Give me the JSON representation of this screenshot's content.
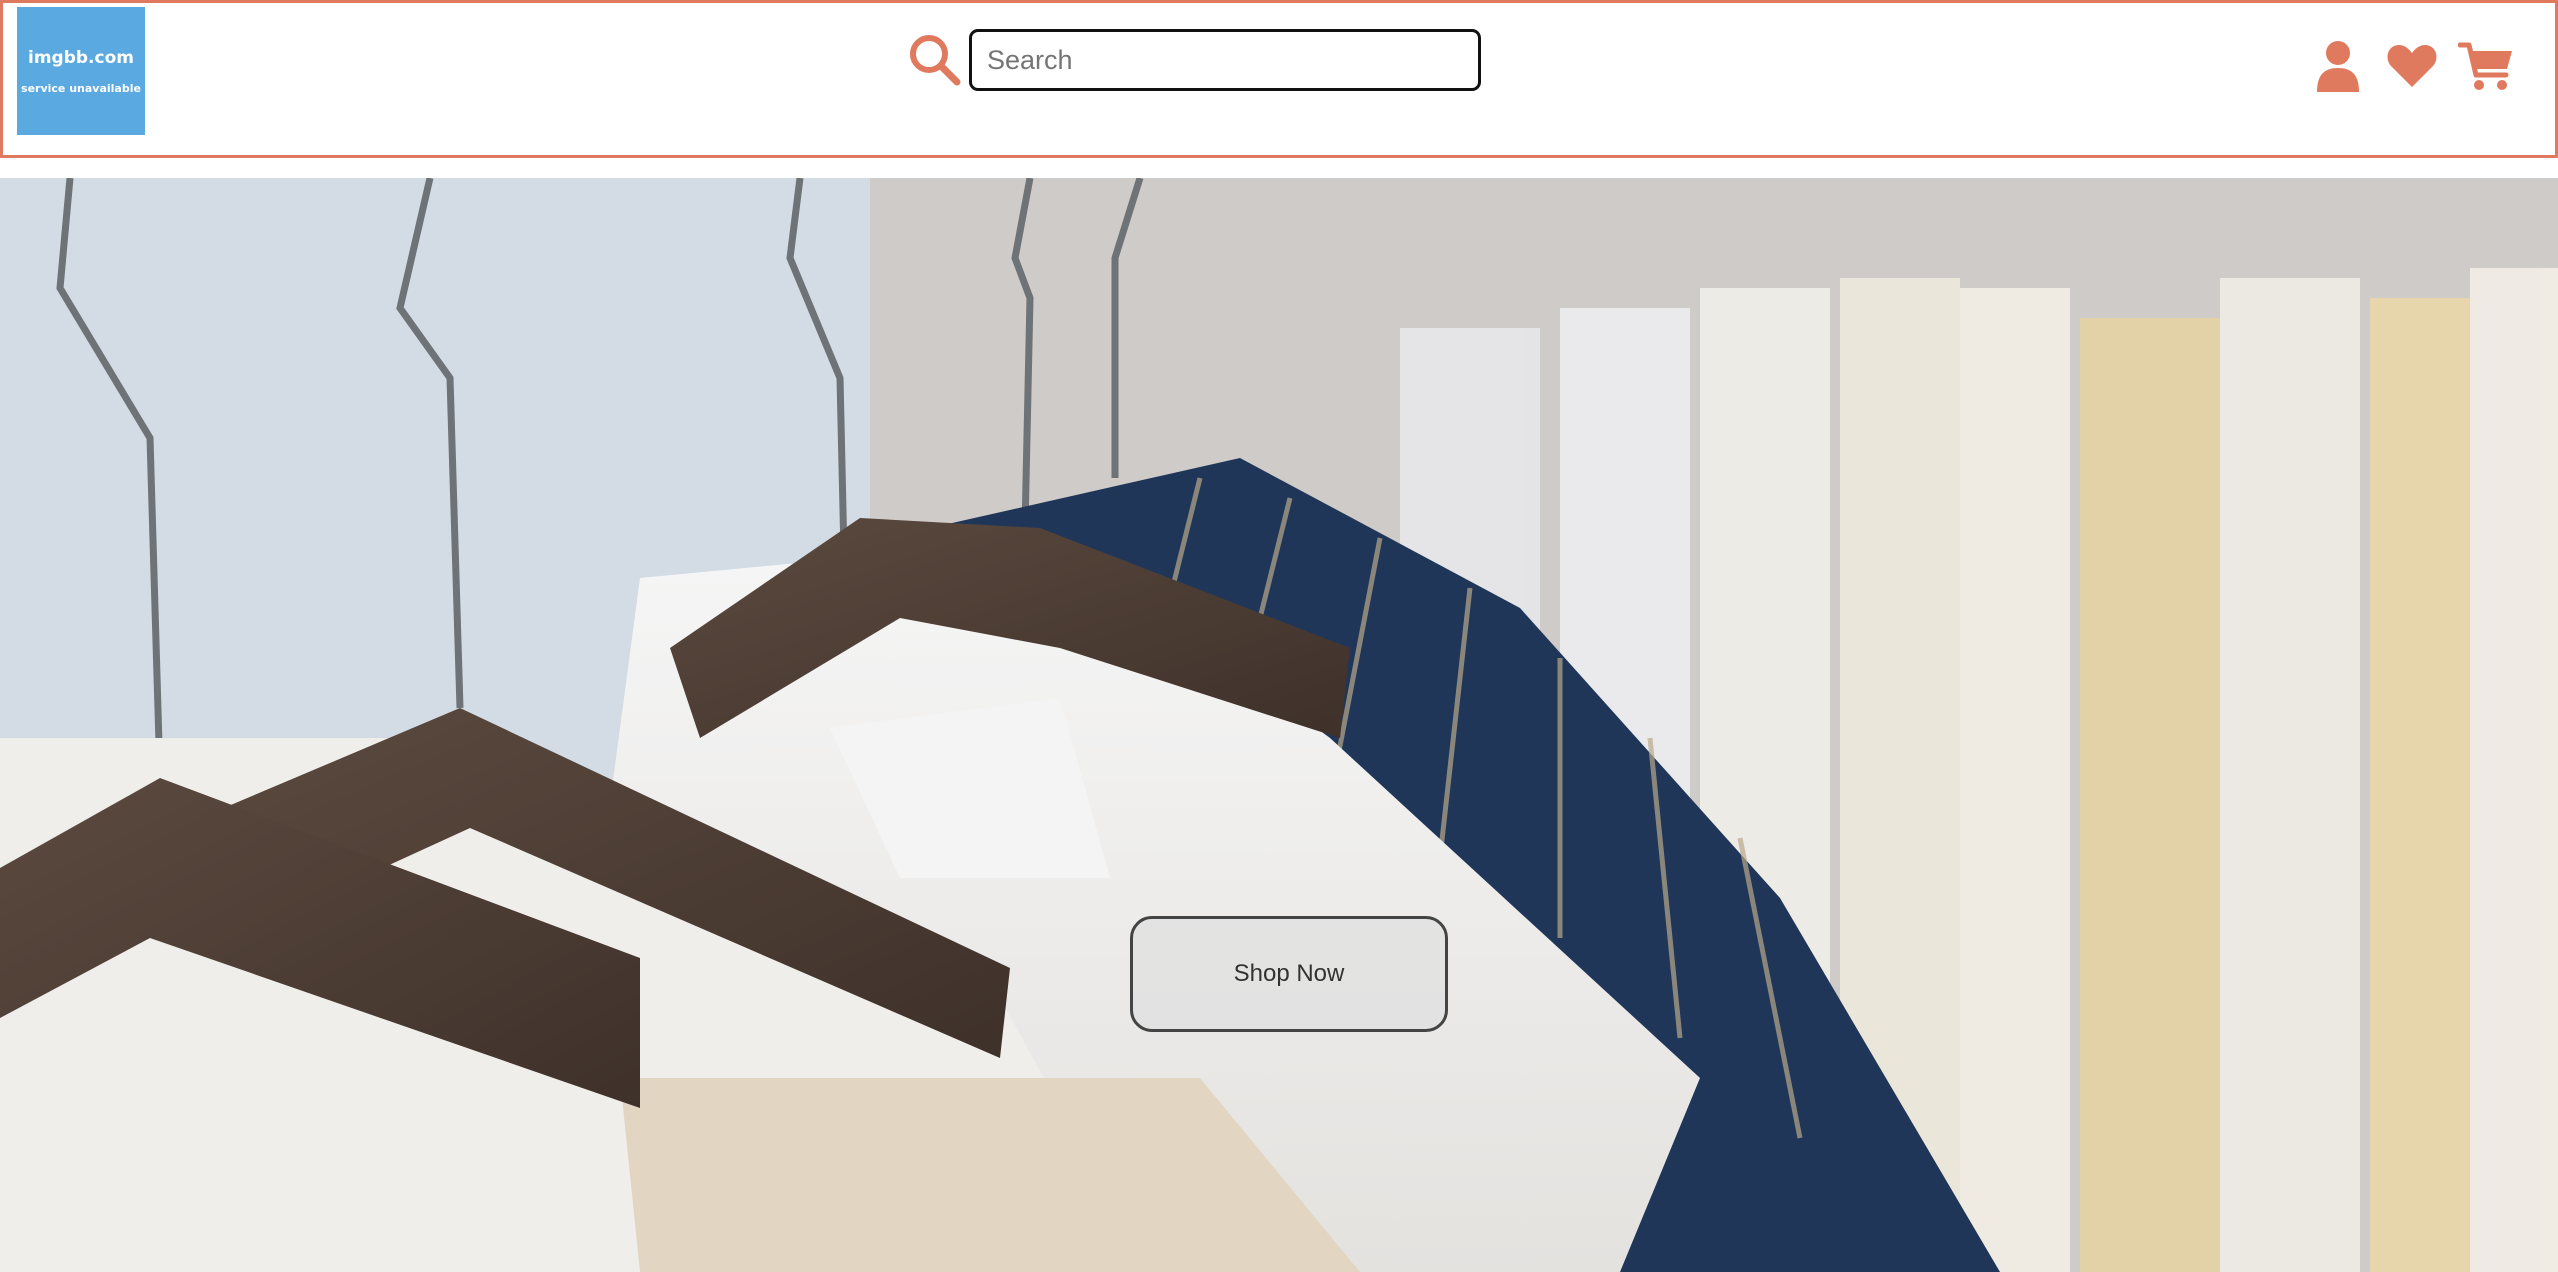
{
  "header": {
    "logo": {
      "title": "imgbb.com",
      "subtitle": "service unavailable"
    },
    "search": {
      "placeholder": "Search",
      "value": ""
    },
    "icons": [
      "search-icon",
      "user-icon",
      "heart-icon",
      "cart-icon"
    ]
  },
  "hero": {
    "cta_label": "Shop Now"
  },
  "colors": {
    "accent": "#e07a5f",
    "logo_bg": "#5aa9e0"
  }
}
